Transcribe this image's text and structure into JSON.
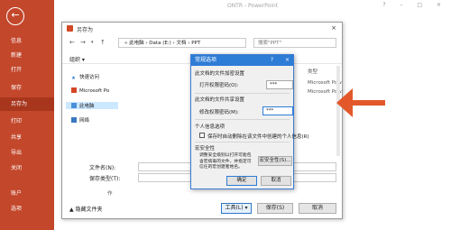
{
  "app": {
    "title": "ONTR - PowerPoint",
    "window_controls": "? – □ ×"
  },
  "sidebar": {
    "back_icon": "back-arrow-icon",
    "items": [
      {
        "label": "信息",
        "active": false
      },
      {
        "label": "新建",
        "active": false
      },
      {
        "label": "打开",
        "active": false
      },
      {
        "label": "保存",
        "active": false
      },
      {
        "label": "另存为",
        "active": true
      },
      {
        "label": "打印",
        "active": false
      },
      {
        "label": "共享",
        "active": false
      },
      {
        "label": "导出",
        "active": false
      },
      {
        "label": "关闭",
        "active": false
      },
      {
        "label": "账户",
        "active": false
      },
      {
        "label": "选项",
        "active": false
      }
    ]
  },
  "save_as": {
    "title": "另存为",
    "close": "×",
    "path": "« 此电脑 › Data (E:) › 文档 › PPT",
    "search_placeholder": "搜索\"PPT\"",
    "organize_label": "组织 ▾",
    "nav_items": [
      {
        "label": "快速访问"
      },
      {
        "label": "Microsoft Po"
      },
      {
        "label": "此电脑"
      },
      {
        "label": "网络"
      }
    ],
    "type_column": {
      "header": "类型",
      "values": [
        "Microsoft Pow",
        "Microsoft Pow"
      ]
    },
    "filename_label": "文件名(N):",
    "filetype_label": "保存类型(T):",
    "author_prefix": "作",
    "hide_folders_label": "▲ 隐藏文件夹",
    "tools_label": "工具(L) ▾",
    "save_label": "保存(S)",
    "cancel_label": "取消"
  },
  "general_options": {
    "title": "常规选项",
    "help": "?",
    "close": "×",
    "encrypt_section": "此文档的文件加密设置",
    "open_pw_label": "打开权限密码(O):",
    "open_pw_value": "***",
    "share_section": "此文档的文件共享设置",
    "modify_pw_label": "修改权限密码(M):",
    "modify_pw_value": "***",
    "privacy_section": "个人信息选项",
    "remove_info_label": "保存时自动删除在该文件中创建的个人信息(R)",
    "remove_info_checked": false,
    "security_section": "宏安全性",
    "security_desc": "调整安全级别以打开可能包含宏病毒的文件，并指定可信任的宏创建者姓名。",
    "macro_button": "宏安全性(S)...",
    "ok_label": "确定",
    "cancel_label": "取消"
  },
  "annotation": {
    "arrow_color": "#e2582b"
  }
}
